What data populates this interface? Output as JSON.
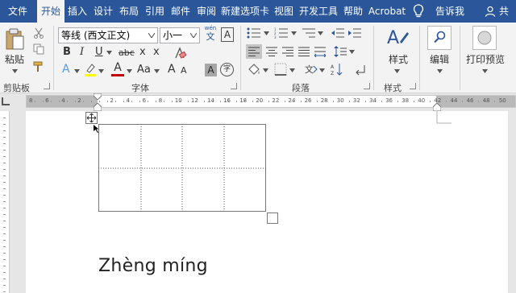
{
  "tabs": [
    {
      "label": "文件",
      "active": false
    },
    {
      "label": "开始",
      "active": true
    },
    {
      "label": "插入",
      "active": false
    },
    {
      "label": "设计",
      "active": false
    },
    {
      "label": "布局",
      "active": false
    },
    {
      "label": "引用",
      "active": false
    },
    {
      "label": "邮件",
      "active": false
    },
    {
      "label": "审阅",
      "active": false
    },
    {
      "label": "新建选项卡",
      "active": false
    },
    {
      "label": "视图",
      "active": false
    },
    {
      "label": "开发工具",
      "active": false
    },
    {
      "label": "帮助",
      "active": false
    },
    {
      "label": "Acrobat",
      "active": false
    }
  ],
  "tell_me": "告诉我",
  "share": "共享",
  "clipboard": {
    "paste": "粘贴",
    "group_label": "剪贴板"
  },
  "font": {
    "name": "等线 (西文正文)",
    "size": "小一",
    "group_label": "字体",
    "bold": "B",
    "italic": "I",
    "underline": "U",
    "strike": "abc",
    "subscript": "x",
    "superscript": "x",
    "phonetic_top": "wén",
    "phonetic_bottom": "文",
    "border_char": "A",
    "grow": "A",
    "shrink": "A",
    "case": "Aa",
    "shade": "A",
    "circle": "字",
    "font_color": "A",
    "text_effect": "A"
  },
  "paragraph": {
    "group_label": "段落"
  },
  "styles": {
    "label": "样式",
    "group_label": "样式"
  },
  "editing": {
    "label": "编辑"
  },
  "print": {
    "label": "打印预览"
  },
  "ruler": {
    "numbers": [
      "8",
      "6",
      "4",
      "2",
      "2",
      "4",
      "6",
      "8",
      "10",
      "12",
      "14",
      "16",
      "18",
      "20",
      "22",
      "24",
      "26",
      "28",
      "30",
      "32",
      "34",
      "36",
      "38",
      "40",
      "42",
      "44",
      "46",
      "48",
      "50"
    ]
  },
  "document": {
    "text": "Zhèng míng",
    "table": {
      "rows": 2,
      "cols": 4
    }
  },
  "colors": {
    "accent": "#2b579a",
    "highlight": "#ffff00",
    "font_color": "#c00000"
  }
}
